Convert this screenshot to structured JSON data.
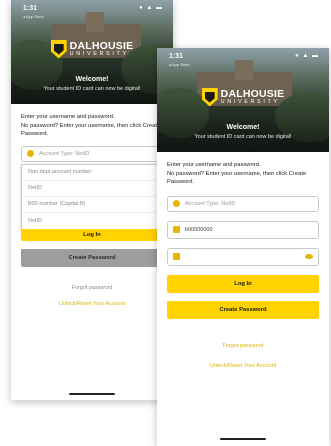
{
  "back_screen": {
    "status_time": "1:31",
    "sub_status": "◂ App Store",
    "status_icons": "● ▲ ▬",
    "logo_line1": "DALHOUSIE",
    "logo_line2": "UNIVERSITY",
    "welcome": "Welcome!",
    "tagline": "Your student ID card can now be digital!",
    "instruction1": "Enter your username and password.",
    "instruction2": "No password? Enter your username, then click Create Password.",
    "account_type_placeholder": "Account Type: NetID",
    "dropdown_options": [
      "Non dept account number",
      "NetID",
      "B00 number (Capital B)",
      "NetID"
    ],
    "login_label": "Log In",
    "create_password_label": "Create Password",
    "forgot_password_label": "Forgot password",
    "unlock_label": "Unlock/Reset Your Account"
  },
  "front_screen": {
    "status_time": "1:31",
    "sub_status": "◂ App Store",
    "status_icons": "● ▲ ▬",
    "logo_line1": "DALHOUSIE",
    "logo_line2": "UNIVERSITY",
    "welcome": "Welcome!",
    "tagline": "Your student ID card can now be digital!",
    "instruction1": "Enter your username and password.",
    "instruction2": "No password? Enter your username, then click Create Password.",
    "account_type_placeholder": "Account Type: NetID",
    "username_value": "b00000000",
    "login_label": "Log In",
    "create_password_label": "Create Password",
    "forgot_password_label": "Forgot password",
    "unlock_label": "Unlock/Reset Your Account"
  },
  "colors": {
    "accent": "#ffd200",
    "secondary_button": "#9d9d9d"
  }
}
